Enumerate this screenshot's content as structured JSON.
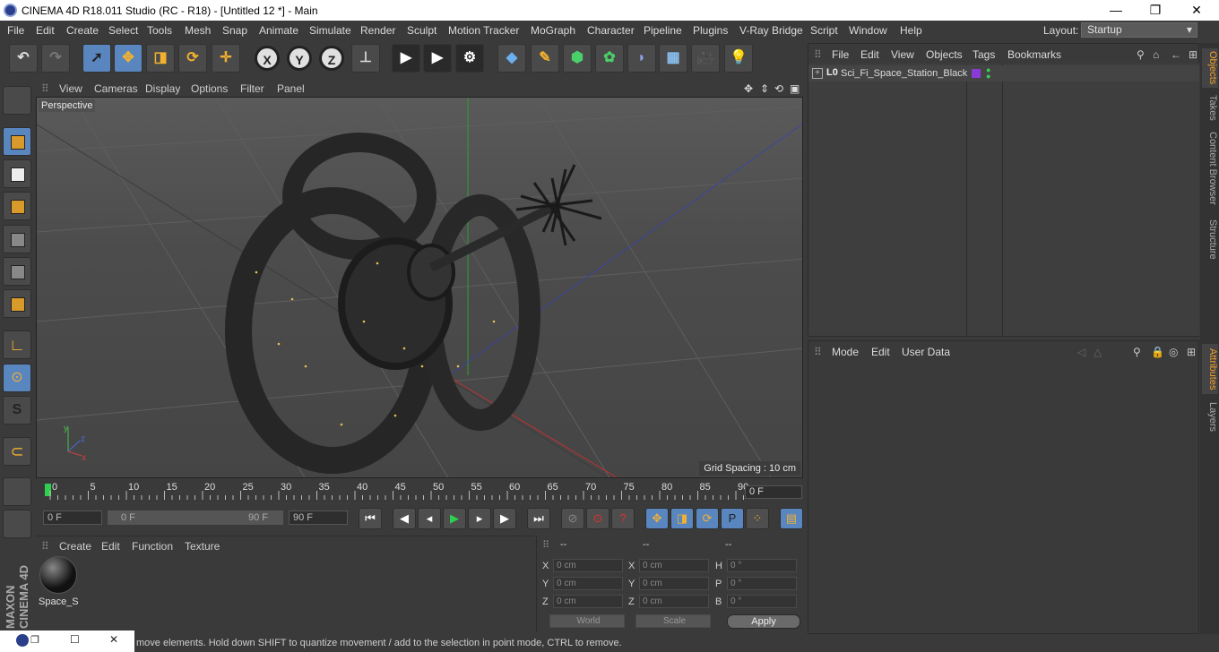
{
  "title_bar": {
    "title": "CINEMA 4D R18.011 Studio (RC - R18) - [Untitled 12 *] - Main",
    "minimize": "—",
    "maximize": "❐",
    "close": "✕"
  },
  "menu": [
    "File",
    "Edit",
    "Create",
    "Select",
    "Tools",
    "Mesh",
    "Snap",
    "Animate",
    "Simulate",
    "Render",
    "Sculpt",
    "Motion Tracker",
    "MoGraph",
    "Character",
    "Pipeline",
    "Plugins",
    "V-Ray Bridge",
    "Script",
    "Window",
    "Help"
  ],
  "layout": {
    "label": "Layout:",
    "value": "Startup"
  },
  "toolbar": {
    "x_label": "X",
    "y_label": "Y",
    "z_label": "Z"
  },
  "viewport": {
    "menu": [
      "View",
      "Cameras",
      "Display",
      "Options",
      "Filter",
      "Panel"
    ],
    "camera_label": "Perspective",
    "grid_spacing": "Grid Spacing : 10 cm"
  },
  "timeline": {
    "ticks": [
      "0",
      "5",
      "10",
      "15",
      "20",
      "25",
      "30",
      "35",
      "40",
      "45",
      "50",
      "55",
      "60",
      "65",
      "70",
      "75",
      "80",
      "85",
      "90"
    ],
    "current_frame": "0 F",
    "start_field": "0 F",
    "range_start": "0 F",
    "range_end": "90 F",
    "end_field": "90 F"
  },
  "material_manager": {
    "menu": [
      "Create",
      "Edit",
      "Function",
      "Texture"
    ],
    "material_name": "Space_S"
  },
  "coordinates": {
    "headers": [
      "--",
      "--",
      "--"
    ],
    "rows": [
      {
        "l1": "X",
        "v1": "0 cm",
        "l2": "X",
        "v2": "0 cm",
        "l3": "H",
        "v3": "0 °"
      },
      {
        "l1": "Y",
        "v1": "0 cm",
        "l2": "Y",
        "v2": "0 cm",
        "l3": "P",
        "v3": "0 °"
      },
      {
        "l1": "Z",
        "v1": "0 cm",
        "l2": "Z",
        "v2": "0 cm",
        "l3": "B",
        "v3": "0 °"
      }
    ],
    "mode": "World",
    "transform": "Scale",
    "apply": "Apply"
  },
  "object_manager": {
    "menu": [
      "File",
      "Edit",
      "View",
      "Objects",
      "Tags",
      "Bookmarks"
    ],
    "object_name": "Sci_Fi_Space_Station_Black"
  },
  "attribute_manager": {
    "menu": [
      "Mode",
      "Edit",
      "User Data"
    ]
  },
  "side_tabs": [
    "Objects",
    "Takes",
    "Content Browser",
    "Structure",
    "Attributes",
    "Layers"
  ],
  "maxon": "MAXON CINEMA 4D",
  "status": "move elements. Hold down SHIFT to quantize movement / add to the selection in point mode, CTRL to remove.",
  "colors": {
    "accent": "#5a86c0",
    "highlight": "#f0a030",
    "object_tag": "#8a3ad6"
  }
}
